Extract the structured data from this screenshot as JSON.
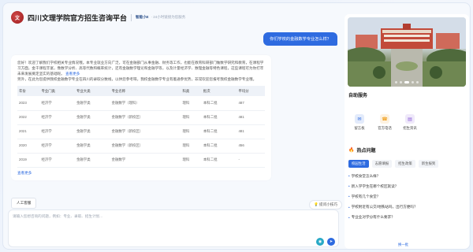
{
  "header": {
    "logo_text": "文",
    "title": "四川文理学院官方招生咨询平台",
    "tagline_bold": "智能小E",
    "tagline": "· 24小时链接为您服务"
  },
  "chat": {
    "user_question": "你们学校的金融数学专业怎么样？",
    "answer_intro": "您好！欢迎了解我们学校相关专业情况哦。本专业就业方向广泛，可在金融部门从事金融、财务等工作，也能在教育科研部门做数学研究和教育，在课程学习方面，金干课程丰富，像数学分析、高等代数和概率统计，还有金融数学理论和金融学等，以及计量经济学、数理金融等特色课程，这些课程可为你打牢未来发展奠定坚实的基础呢。",
    "more_link": "查看更多",
    "answer_extra": "另外，在此为您提供我校金融数学专业在四川的录取分数线，以供您参考呀。我校金融数学专业有着通参优势，非常欢迎您报考我校金融数学专业哦。",
    "table": {
      "headers": [
        "年份",
        "专业门类",
        "专业大类",
        "专业名称",
        "科类",
        "批次",
        "平均分"
      ],
      "rows": [
        [
          "2023",
          "经济学",
          "金融学类",
          "金融数学（理科）",
          "理科",
          "本科二批",
          "487"
        ],
        [
          "2022",
          "经济学",
          "金融学类",
          "金融数学（新校区）",
          "理科",
          "本科二批",
          "481"
        ],
        [
          "2021",
          "经济学",
          "金融学类",
          "金融数学（新校区）",
          "理科",
          "本科二批",
          "481"
        ],
        [
          "2020",
          "经济学",
          "金融学类",
          "金融数学（新校区）",
          "理科",
          "本科二批",
          "456"
        ],
        [
          "2019",
          "经济学",
          "金融学类",
          "金融数学",
          "理科",
          "本科二批",
          "-"
        ]
      ]
    },
    "view_more_label": "查看更多",
    "manual_button": "人工客服",
    "tips_label": "提问小技巧",
    "input_placeholder": "请输入您想咨询的问题，例如：专业、录取、招生计划..."
  },
  "side": {
    "banner_dots": 5,
    "banner_active_dot": 2,
    "services_title": "自助服务",
    "services": [
      {
        "label": "留言板",
        "icon": "message-icon",
        "color": "#2e6be0"
      },
      {
        "label": "官方电话",
        "icon": "phone-icon",
        "color": "#f0a020"
      },
      {
        "label": "招生资讯",
        "icon": "news-icon",
        "color": "#8a5cd6"
      }
    ],
    "hot_title": "热点问题",
    "tabs": [
      "校园生活",
      "志愿填报",
      "招生政策",
      "新生报到"
    ],
    "active_tab": 0,
    "questions": [
      "学校食堂怎么样？",
      "新入学学生在哪个校区就读？",
      "学校有几个食堂？",
      "学校附近有公交/地铁站吗，出行方便吗？",
      "专业业对学分有什么要求？"
    ],
    "change_label": "换一批"
  }
}
